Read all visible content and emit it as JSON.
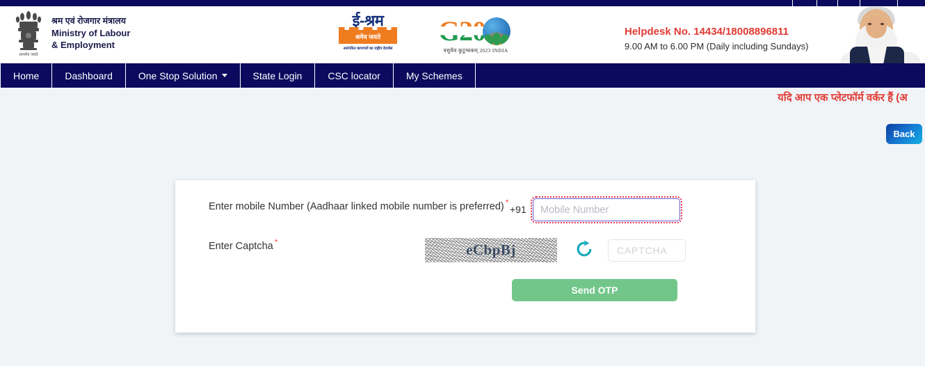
{
  "topbar": {
    "ticks": 5
  },
  "header": {
    "ministry": {
      "emblem_icon": "national-emblem-icon",
      "line_hi": "श्रम एवं रोजगार मंत्रालय",
      "line_en_1": "Ministry of Labour",
      "line_en_2": "& Employment"
    },
    "eshram_logo": {
      "word": "ई-श्रम",
      "tagline_hi": "श्रमेव जयते",
      "subtitle_hi": "असंगठित कामगारों का राष्ट्रीय डेटाबेस"
    },
    "g20_logo": {
      "mark": "G20",
      "caption": "वसुधैव कुटुम्बकम् 2023 INDIA"
    },
    "helpdesk": {
      "number_line": "Helpdesk No. 14434/18008896811",
      "hours_line": "9.00 AM to 6.00 PM (Daily including Sundays)"
    },
    "pm_photo": "prime-minister-photo"
  },
  "nav": {
    "items": [
      {
        "label": "Home",
        "has_caret": false
      },
      {
        "label": "Dashboard",
        "has_caret": false
      },
      {
        "label": "One Stop Solution",
        "has_caret": true
      },
      {
        "label": "State Login",
        "has_caret": false
      },
      {
        "label": "CSC locator",
        "has_caret": false
      },
      {
        "label": "My Schemes",
        "has_caret": false
      }
    ]
  },
  "marquee": {
    "text": "यदि आप एक प्लेटफॉर्म वर्कर हैं (अ"
  },
  "back_button": {
    "label": "Back"
  },
  "form": {
    "mobile": {
      "label": "Enter mobile Number (Aadhaar linked mobile number is preferred)",
      "required_marker": "*",
      "country_code": "+91",
      "placeholder": "Mobile Number",
      "value": ""
    },
    "captcha": {
      "label": "Enter Captcha",
      "required_marker": "*",
      "image_text": "eCbpBj",
      "refresh_icon": "refresh-icon",
      "placeholder": "CAPTCHA",
      "value": ""
    },
    "submit": {
      "label": "Send OTP"
    }
  },
  "colors": {
    "navy": "#0b0a5e",
    "page_bg": "#f0f4f7",
    "helpdesk_red": "#e03b33",
    "marquee_red": "#e03b33",
    "refresh_teal": "#16a9bd",
    "send_otp_green": "#72c68a",
    "required_red": "#ff4d4f"
  }
}
